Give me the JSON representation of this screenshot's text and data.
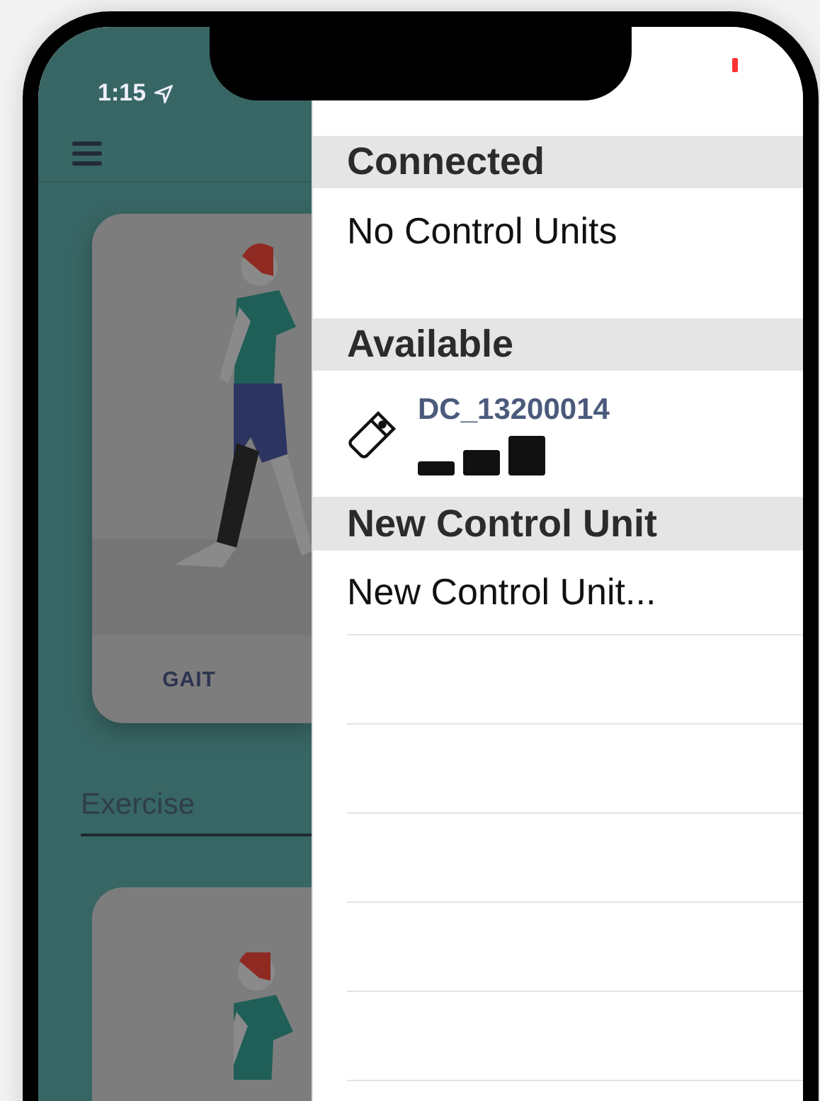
{
  "status_bar": {
    "time": "1:15"
  },
  "background_app": {
    "card_label": "GAIT",
    "field": {
      "placeholder": "Exercise"
    }
  },
  "panel": {
    "sections": [
      {
        "header": "Connected",
        "rows": [
          {
            "kind": "text",
            "label": "No Control Units"
          }
        ]
      },
      {
        "header": "Available",
        "rows": [
          {
            "kind": "device",
            "label": "DC_13200014"
          }
        ]
      },
      {
        "header": "New Control Unit",
        "rows": [
          {
            "kind": "action",
            "label": "New Control Unit..."
          }
        ]
      }
    ]
  }
}
